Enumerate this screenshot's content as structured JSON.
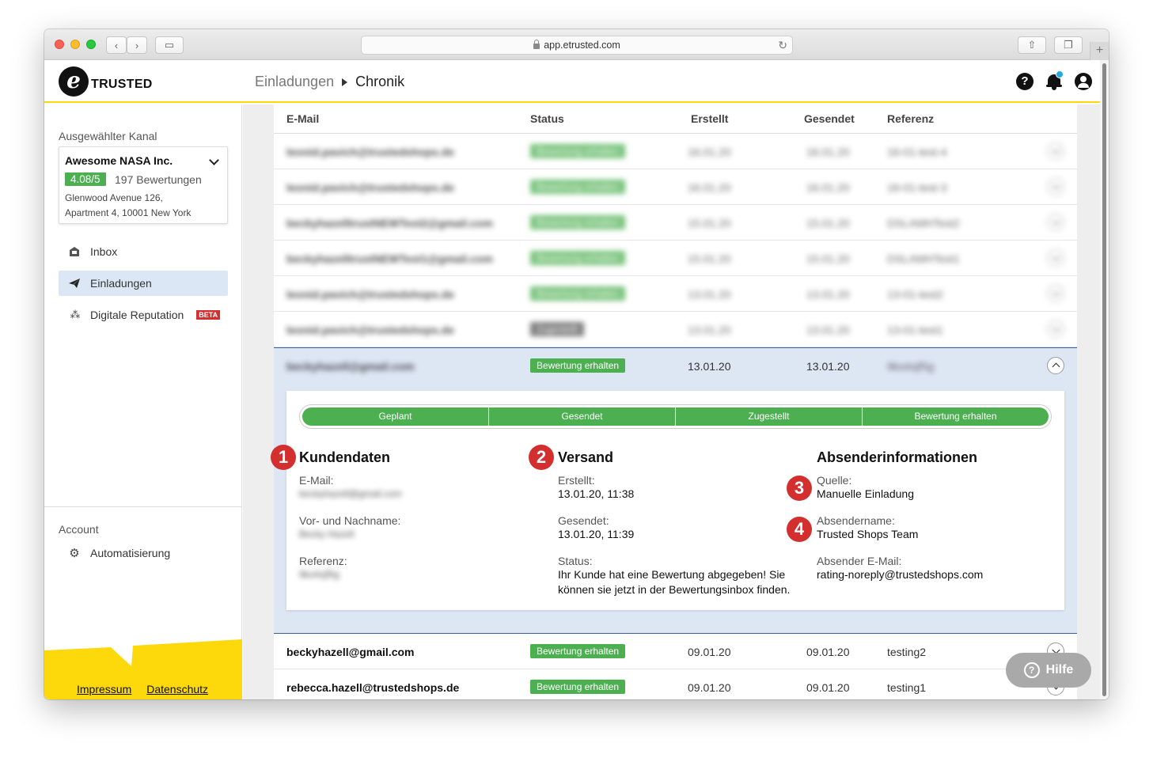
{
  "browser": {
    "url": "app.etrusted.com"
  },
  "header": {
    "logo_letter": "e",
    "logo_text": "TRUSTED",
    "breadcrumb": [
      "Einladungen",
      "Chronik"
    ]
  },
  "sidebar": {
    "selected_channel_label": "Ausgewählter Kanal",
    "channel": {
      "name": "Awesome NASA Inc.",
      "score": "4.08/5",
      "reviews": "197 Bewertungen",
      "address_line1": "Glenwood Avenue 126,",
      "address_line2": "Apartment 4, 10001 New York"
    },
    "nav": [
      {
        "label": "Inbox",
        "icon": "inbox-icon"
      },
      {
        "label": "Einladungen",
        "icon": "paper-plane-icon"
      },
      {
        "label": "Digitale Reputation",
        "icon": "sparkle-icon",
        "badge": "BETA"
      }
    ],
    "account_label": "Account",
    "account_nav": [
      {
        "label": "Automatisierung",
        "icon": "gear-robot-icon"
      }
    ],
    "footer": {
      "impressum": "Impressum",
      "datenschutz": "Datenschutz"
    }
  },
  "table": {
    "headers": {
      "email": "E-Mail",
      "status": "Status",
      "created": "Erstellt",
      "sent": "Gesendet",
      "reference": "Referenz"
    },
    "blurred_rows": [
      {
        "email": "leonid.pavich@trustedshops.de",
        "status": "Bewertung erhalten",
        "created": "16.01.20",
        "sent": "16.01.20",
        "reference": "16-01-test-4",
        "grey": false
      },
      {
        "email": "leonid.pavich@trustedshops.de",
        "status": "Bewertung erhalten",
        "created": "16.01.20",
        "sent": "16.01.20",
        "reference": "16-01-test-3",
        "grey": false
      },
      {
        "email": "beckyhazelltrustNEWTest2@gmail.com",
        "status": "Bewertung erhalten",
        "created": "15.01.20",
        "sent": "15.01.20",
        "reference": "DSLAMHTest2",
        "grey": false
      },
      {
        "email": "beckyhazelltrustNEWTest1@gmail.com",
        "status": "Bewertung erhalten",
        "created": "15.01.20",
        "sent": "15.01.20",
        "reference": "DSLAMHTest1",
        "grey": false
      },
      {
        "email": "leonid.pavich@trustedshops.de",
        "status": "Bewertung erhalten",
        "created": "13.01.20",
        "sent": "13.01.20",
        "reference": "13-01-test2",
        "grey": false
      },
      {
        "email": "leonid.pavich@trustedshops.de",
        "status": "Zugestellt",
        "created": "13.01.20",
        "sent": "13.01.20",
        "reference": "13-01-test1",
        "grey": true
      }
    ],
    "expanded_row": {
      "email": "beckyhazell@gmail.com",
      "status": "Bewertung erhalten",
      "created": "13.01.20",
      "sent": "13.01.20",
      "reference": "9ks4sjf5g",
      "progress": [
        "Geplant",
        "Gesendet",
        "Zugestellt",
        "Bewertung erhalten"
      ],
      "kundendaten": {
        "title": "Kundendaten",
        "email_label": "E-Mail:",
        "email_value": "beckyhazell@gmail.com",
        "name_label": "Vor- und Nachname:",
        "name_value": "Becky Hazell",
        "ref_label": "Referenz:",
        "ref_value": "9ks4sjf5g"
      },
      "versand": {
        "title": "Versand",
        "created_label": "Erstellt:",
        "created_value": "13.01.20, 11:38",
        "sent_label": "Gesendet:",
        "sent_value": "13.01.20, 11:39",
        "status_label": "Status:",
        "status_value": "Ihr Kunde hat eine Bewertung abgegeben! Sie können sie jetzt in der Bewertungsinbox finden."
      },
      "absender": {
        "title": "Absenderinformationen",
        "source_label": "Quelle:",
        "source_value": "Manuelle Einladung",
        "sender_name_label": "Absendername:",
        "sender_name_value": "Trusted Shops Team",
        "sender_email_label": "Absender E-Mail:",
        "sender_email_value": "rating-noreply@trustedshops.com"
      },
      "markers": [
        "1",
        "2",
        "3",
        "4"
      ]
    },
    "rows": [
      {
        "email": "beckyhazell@gmail.com",
        "status": "Bewertung erhalten",
        "created": "09.01.20",
        "sent": "09.01.20",
        "reference": "testing2"
      },
      {
        "email": "rebecca.hazell@trustedshops.de",
        "status": "Bewertung erhalten",
        "created": "09.01.20",
        "sent": "09.01.20",
        "reference": "testing1"
      }
    ]
  },
  "help_button": {
    "label": "Hilfe"
  },
  "colors": {
    "accent_yellow": "#fdd90c",
    "success_green": "#4caf50",
    "marker_red": "#d32f2f",
    "selected_blue": "#dce7f6"
  }
}
